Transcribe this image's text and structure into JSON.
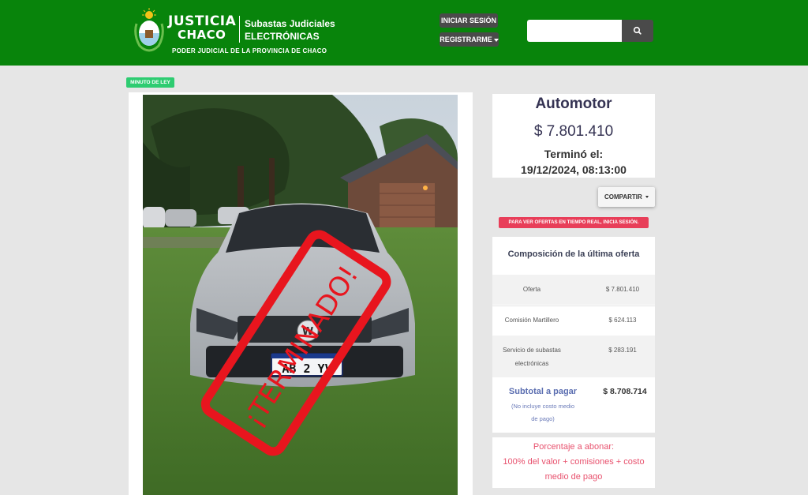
{
  "header": {
    "brand_line1": "JUSTICIA",
    "brand_line2": "CHACO",
    "brand_line3": "Subastas Judiciales",
    "brand_line4": "ELECTRÓNICAS",
    "brand_tagline": "PODER JUDICIAL DE LA PROVINCIA DE CHACO",
    "login_label": "INICIAR SESIÓN",
    "register_label": "REGISTRARME",
    "search_placeholder": "",
    "search_value": ""
  },
  "listing": {
    "badge": "MINUTO DE LEY",
    "photo_stamp": "¡TERMINADO!",
    "license_plate": "AB 2  YV",
    "title": "Automotor",
    "price": "$ 7.801.410",
    "ended_label": "Terminó el:",
    "ended_datetime": "19/12/2024, 08:13:00",
    "share_label": "COMPARTIR",
    "realtime_notice": "PARA VER OFERTAS EN TIEMPO REAL, INICIA SESIÓN."
  },
  "composition": {
    "title": "Composición de la última oferta",
    "rows": [
      {
        "label": "Oferta",
        "value": "$ 7.801.410"
      },
      {
        "label": "Comisión Martillero",
        "value": "$ 624.113"
      },
      {
        "label_line1": "Servicio de subastas",
        "label_line2": "electrónicas",
        "value": "$ 283.191"
      }
    ],
    "subtotal_label": "Subtotal a pagar",
    "subtotal_note_line1": "(No incluye costo medio",
    "subtotal_note_line2": "de pago)",
    "subtotal_value": "$ 8.708.714"
  },
  "payment": {
    "line1": "Porcentaje a abonar:",
    "line2": "100% del valor + comisiones + costo",
    "line3": "medio de pago"
  },
  "colors": {
    "header_green": "#08840b",
    "badge_green": "#2ecc71",
    "notice_red": "#e83e59",
    "stamp_red": "#e8151e",
    "subtotal_blue": "#5a6db0"
  }
}
